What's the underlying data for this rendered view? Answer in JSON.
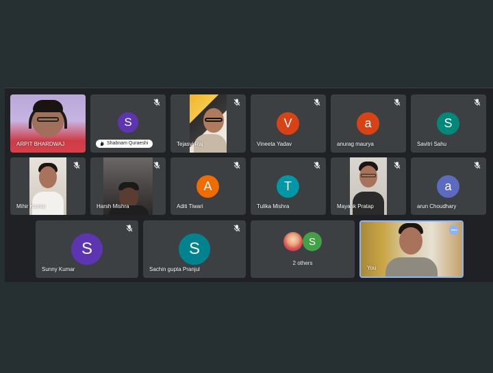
{
  "participants": [
    {
      "name": "ARPIT BHARDWAJ",
      "type": "video"
    },
    {
      "name": "Shabnam Quraeshi",
      "type": "avatar",
      "initial": "S",
      "color": "#5e35b1",
      "hand_raised": true
    },
    {
      "name": "Tejasvi Raj",
      "type": "video"
    },
    {
      "name": "Vineeta Yadav",
      "type": "avatar",
      "initial": "V",
      "color": "#d84315"
    },
    {
      "name": "anurag maurya",
      "type": "avatar",
      "initial": "a",
      "color": "#d84315"
    },
    {
      "name": "Savitri Sahu",
      "type": "avatar",
      "initial": "S",
      "color": "#00897b"
    },
    {
      "name": "Mihir Kumar",
      "type": "video"
    },
    {
      "name": "Harsh Mishra",
      "type": "video"
    },
    {
      "name": "Aditi Tiwari",
      "type": "avatar",
      "initial": "A",
      "color": "#ef6c00"
    },
    {
      "name": "Tulika Mishra",
      "type": "avatar",
      "initial": "T",
      "color": "#0097a7"
    },
    {
      "name": "Mayank Pratap",
      "type": "video"
    },
    {
      "name": "arun Choudhary",
      "type": "avatar",
      "initial": "a",
      "color": "#5c6bc0"
    },
    {
      "name": "Sunny Kumar",
      "type": "avatar",
      "initial": "S",
      "color": "#5e35b1"
    },
    {
      "name": "Sachin gupta Pranjul",
      "type": "avatar",
      "initial": "S",
      "color": "#00838f"
    }
  ],
  "others_tile": {
    "label": "2 others",
    "initial": "S",
    "color": "#43a047"
  },
  "self_tile": {
    "name": "You"
  },
  "icons": {
    "mic_muted": "mic-off-icon",
    "hand": "hand-raised-icon",
    "more": "more-options-icon"
  },
  "colors": {
    "tile_bg": "#3c4043",
    "stage_bg": "#202124",
    "page_bg": "#263032",
    "self_border": "#8ab4f8"
  }
}
